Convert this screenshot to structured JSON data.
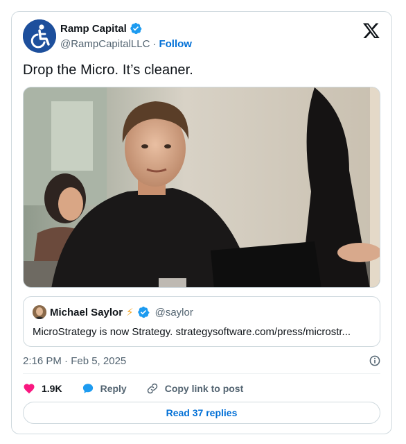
{
  "author": {
    "display_name": "Ramp Capital",
    "handle": "@RampCapitalLLC",
    "separator": "·",
    "follow_label": "Follow",
    "verified_color": "#1d9bf0",
    "avatar_icon": "wheelchair-accessibility-icon"
  },
  "tweet": {
    "text": "Drop the Micro. It’s cleaner.",
    "timestamp": "2:16 PM · Feb 5, 2025"
  },
  "quote": {
    "display_name": "Michael Saylor",
    "emoji": "⚡",
    "handle": "@saylor",
    "text": "MicroStrategy is now Strategy. strategysoftware.com/press/microstr..."
  },
  "actions": {
    "likes_count": "1.9K",
    "reply_label": "Reply",
    "copy_label": "Copy link to post"
  },
  "read_replies_label": "Read 37 replies",
  "colors": {
    "like": "#f91880",
    "reply": "#1d9bf0",
    "link_blue": "#006fd6",
    "muted": "#536471"
  }
}
